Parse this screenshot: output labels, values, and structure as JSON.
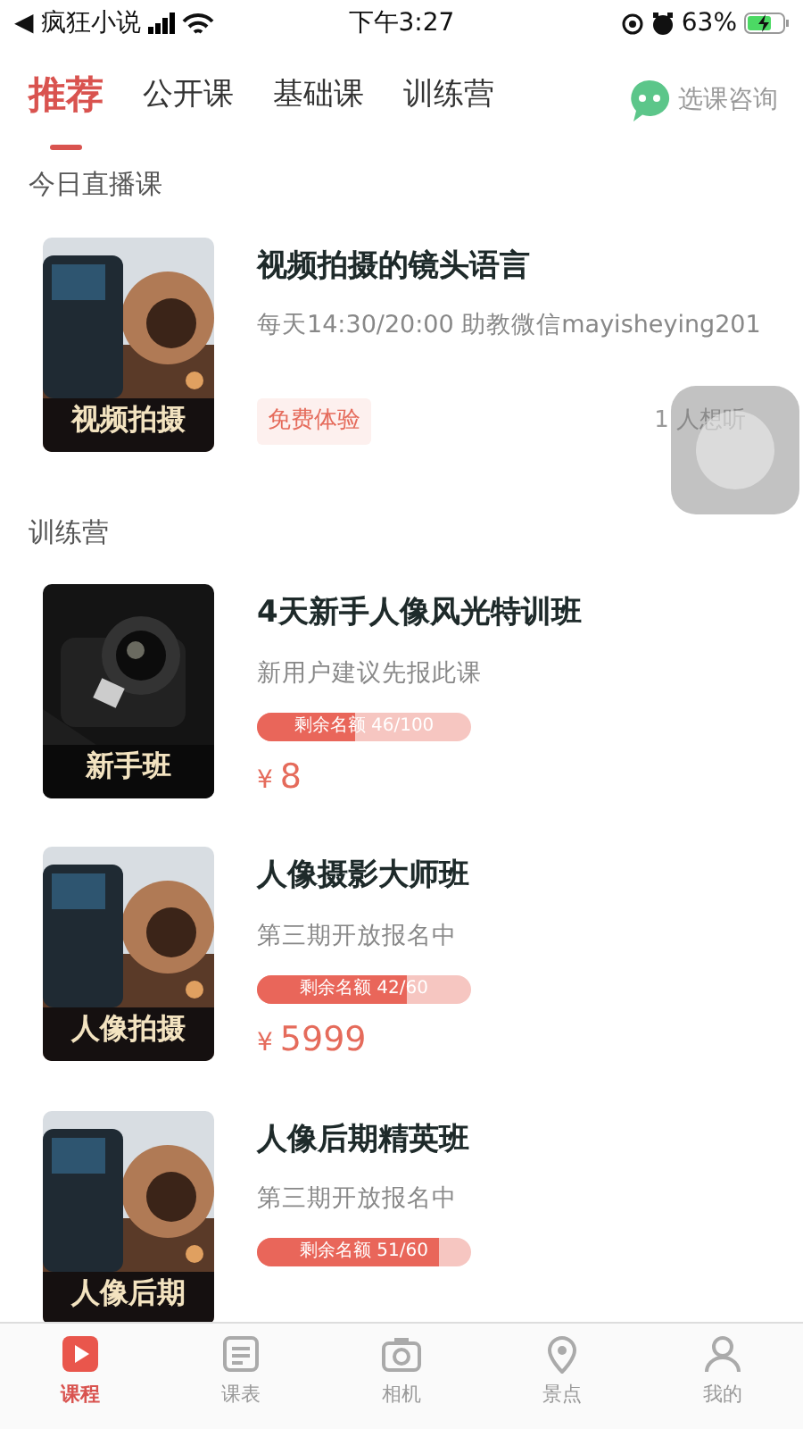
{
  "status_bar": {
    "back_app": "◀ 疯狂小说",
    "time": "下午3:27",
    "battery": "63%"
  },
  "top_tabs": [
    {
      "label": "推荐",
      "selected": true
    },
    {
      "label": "公开课",
      "selected": false
    },
    {
      "label": "基础课",
      "selected": false
    },
    {
      "label": "训练营",
      "selected": false
    }
  ],
  "consult_button": "选课咨询",
  "live_section": {
    "title": "今日直播课",
    "course": {
      "thumb_label": "视频拍摄",
      "title": "视频拍摄的镜头语言",
      "subtitle": "每天14:30/20:00 助教微信mayisheying201",
      "tag": "免费体验",
      "interest": "1 人想听"
    }
  },
  "camp_section": {
    "title": "训练营",
    "courses": [
      {
        "thumb_label": "新手班",
        "title": "4天新手人像风光特训班",
        "subtitle": "新用户建议先报此课",
        "quota": "剩余名额 46/100",
        "level": 0.46,
        "currency": "¥",
        "price": "8"
      },
      {
        "thumb_label": "人像拍摄",
        "title": "人像摄影大师班",
        "subtitle": "第三期开放报名中",
        "quota": "剩余名额 42/60",
        "level": 0.7,
        "currency": "¥",
        "price": "5999"
      },
      {
        "thumb_label": "人像后期",
        "title": "人像后期精英班",
        "subtitle": "第三期开放报名中",
        "quota": "剩余名额 51/60",
        "level": 0.85
      }
    ]
  },
  "bottom_tabs": [
    {
      "label": "课程",
      "selected": true,
      "kind": "play"
    },
    {
      "label": "课表",
      "selected": false,
      "kind": "list"
    },
    {
      "label": "相机",
      "selected": false,
      "kind": "camera"
    },
    {
      "label": "景点",
      "selected": false,
      "kind": "pin"
    },
    {
      "label": "我的",
      "selected": false,
      "kind": "person"
    }
  ]
}
